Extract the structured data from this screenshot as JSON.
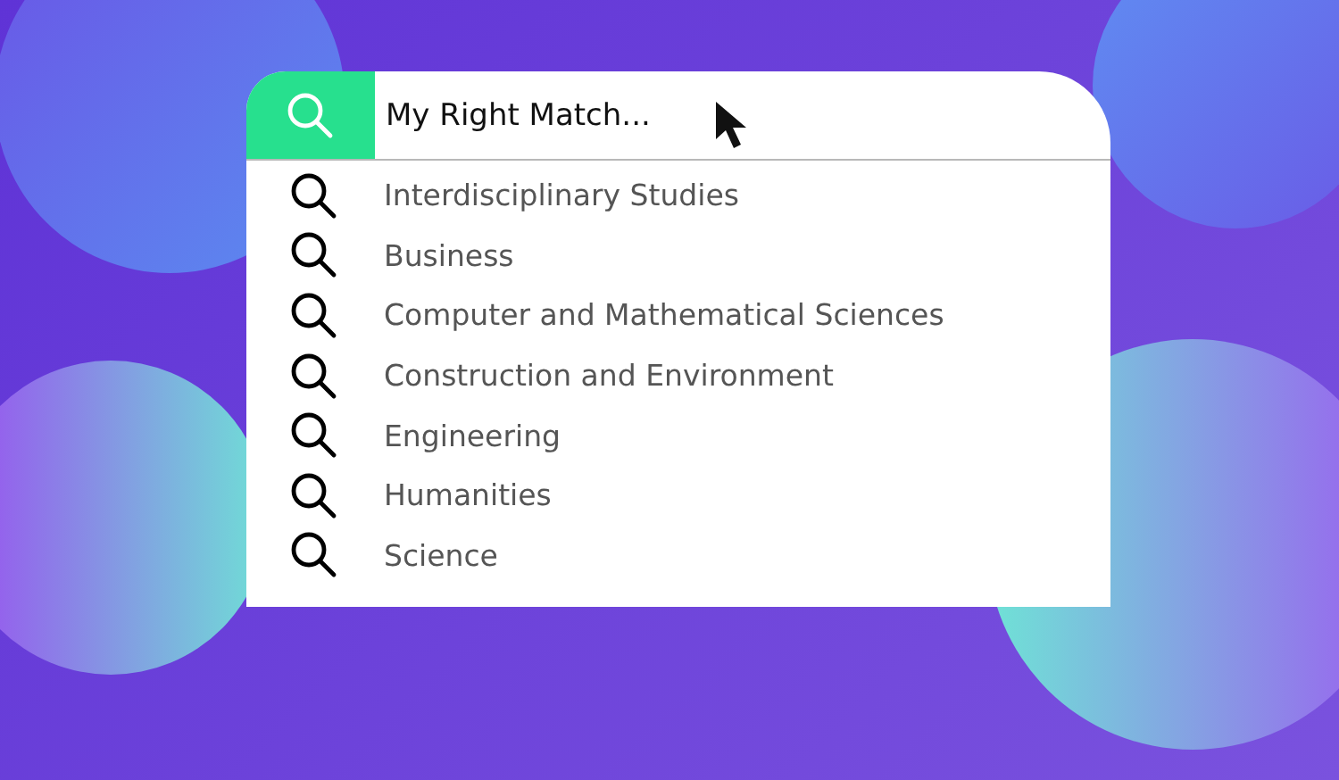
{
  "search": {
    "value": "My Right Match..."
  },
  "suggestions": [
    {
      "label": "Interdisciplinary Studies"
    },
    {
      "label": "Business"
    },
    {
      "label": "Computer and Mathematical Sciences"
    },
    {
      "label": "Construction and Environment"
    },
    {
      "label": "Engineering"
    },
    {
      "label": "Humanities"
    },
    {
      "label": "Science"
    }
  ]
}
